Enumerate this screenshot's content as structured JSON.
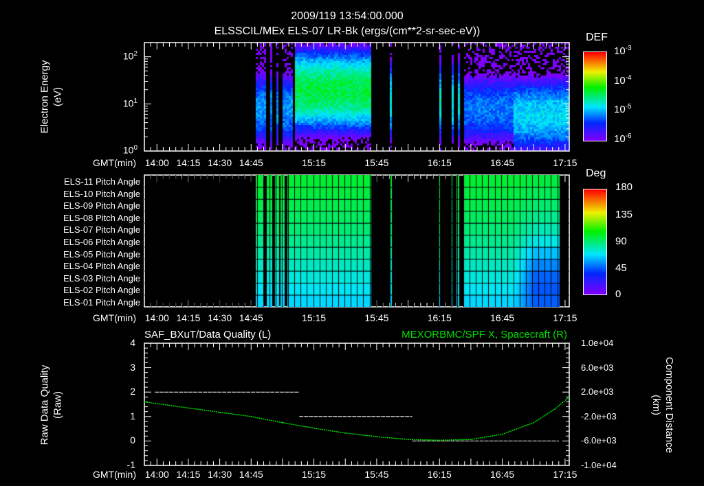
{
  "header": {
    "title": "2009/119 13:54:00.000",
    "subtitle": "ELSSCIL/MEx ELS-07 LR-Bk  (ergs/(cm**2-sr-sec-eV))"
  },
  "time_axis": {
    "label": "GMT(min)",
    "range_min": [
      "13:54",
      "17:17"
    ],
    "tick_labels": [
      "14:00",
      "14:15",
      "14:30",
      "14:45",
      "15:15",
      "15:45",
      "16:15",
      "16:45",
      "17:15"
    ]
  },
  "colors": {
    "background": "#000000",
    "axes": "#ffffff",
    "spacecraft_line": "#00dd00",
    "quality_line": "#ffffff"
  },
  "chart_data": [
    {
      "type": "heatmap",
      "name": "energy-spectrogram",
      "ylabel": "Electron Energy",
      "ylabel_units": "(eV)",
      "yscale": "log",
      "ylim": [
        1,
        200
      ],
      "y_ticks": [
        {
          "base": "10",
          "exp": "0",
          "value": 1
        },
        {
          "base": "10",
          "exp": "1",
          "value": 10
        },
        {
          "base": "10",
          "exp": "2",
          "value": 100
        }
      ],
      "colorbar": {
        "title": "DEF",
        "scale": "log",
        "range": [
          1e-06,
          0.001
        ],
        "labels": [
          {
            "base": "10",
            "exp": "-3"
          },
          {
            "base": "10",
            "exp": "-4"
          },
          {
            "base": "10",
            "exp": "-5"
          },
          {
            "base": "10",
            "exp": "-6"
          }
        ]
      },
      "data_intervals": [
        [
          "14:47",
          "14:52"
        ],
        [
          "14:54",
          "14:55"
        ],
        [
          "14:57",
          "14:58"
        ],
        [
          "15:00",
          "15:04"
        ],
        [
          "15:05",
          "15:42"
        ],
        [
          "15:51",
          "15:52"
        ],
        [
          "16:14",
          "16:15"
        ],
        [
          "16:20",
          "16:21"
        ],
        [
          "16:23",
          "16:24"
        ],
        [
          "16:26",
          "17:17"
        ]
      ],
      "bands": [
        {
          "start": "14:47",
          "end": "15:05",
          "peak_eV": 8,
          "peak_log_def": -4.9
        },
        {
          "start": "15:05",
          "end": "15:42",
          "peak_eV": 20,
          "peak_log_def": -4.2
        },
        {
          "start": "15:51",
          "end": "16:24",
          "peak_eV": 12,
          "peak_log_def": -4.6
        },
        {
          "start": "16:26",
          "end": "16:50",
          "peak_eV": 8,
          "peak_log_def": -5.0
        },
        {
          "start": "16:50",
          "end": "17:17",
          "peak_eV": 6,
          "peak_log_def": -4.7
        }
      ]
    },
    {
      "type": "heatmap",
      "name": "pitch-angle",
      "rows": [
        "ELS-11 Pitch Angle",
        "ELS-10 Pitch Angle",
        "ELS-09 Pitch Angle",
        "ELS-08 Pitch Angle",
        "ELS-07 Pitch Angle",
        "ELS-06 Pitch Angle",
        "ELS-05 Pitch Angle",
        "ELS-04 Pitch Angle",
        "ELS-03 Pitch Angle",
        "ELS-02 Pitch Angle",
        "ELS-01 Pitch Angle"
      ],
      "row_values_deg": [
        100,
        98,
        96,
        93,
        90,
        86,
        82,
        78,
        74,
        70,
        66
      ],
      "late_row_values_deg": [
        98,
        95,
        91,
        86,
        80,
        72,
        62,
        52,
        46,
        44,
        45
      ],
      "late_start": "16:50",
      "data_intervals": [
        [
          "14:47",
          "14:51"
        ],
        [
          "14:52",
          "14:55"
        ],
        [
          "14:56",
          "14:58"
        ],
        [
          "14:59",
          "15:01"
        ],
        [
          "15:02",
          "15:42"
        ],
        [
          "15:51",
          "15:52"
        ],
        [
          "16:14",
          "16:15"
        ],
        [
          "16:20",
          "16:21"
        ],
        [
          "16:23",
          "16:24"
        ],
        [
          "16:26",
          "17:12"
        ]
      ],
      "colorbar": {
        "title": "Deg",
        "range": [
          0,
          180
        ],
        "labels": [
          "180",
          "135",
          "90",
          "45",
          "0"
        ]
      }
    },
    {
      "type": "line",
      "name": "quality-and-position",
      "title_left": "SAF_BXuT/Data Quality (L)",
      "title_right": "MEXORBMC/SPF X, Spacecraft (R)",
      "ylabel_left": "Raw Data Quality",
      "ylabel_left_units": "(Raw)",
      "ylabel_right": "Component Distance",
      "ylabel_right_units": "(km)",
      "ylim_left": [
        -1,
        4
      ],
      "ylim_right": [
        -10000,
        10000
      ],
      "left_tick_labels": [
        "4",
        "3",
        "2",
        "1",
        "0",
        "-1"
      ],
      "right_tick_labels": [
        "1.0e+04",
        "6.0e+03",
        "2.0e+03",
        "-2.0e+03",
        "-6.0e+03",
        "-1.0e+04"
      ],
      "series": [
        {
          "name": "Data Quality",
          "axis": "left",
          "segments": [
            {
              "start": "13:59",
              "end": "15:08",
              "value": 2
            },
            {
              "start": "15:08",
              "end": "16:02",
              "value": 1
            },
            {
              "start": "16:02",
              "end": "17:12",
              "value": 0
            }
          ]
        },
        {
          "name": "SPF X, Spacecraft",
          "axis": "right",
          "x": [
            "13:54",
            "14:15",
            "14:30",
            "14:45",
            "15:00",
            "15:15",
            "15:30",
            "15:45",
            "16:00",
            "16:15",
            "16:30",
            "16:45",
            "17:00",
            "17:10",
            "17:17"
          ],
          "y": [
            400,
            -600,
            -1300,
            -2000,
            -3000,
            -3900,
            -4700,
            -5300,
            -5750,
            -5880,
            -5750,
            -4900,
            -3000,
            -800,
            1200
          ]
        }
      ]
    }
  ]
}
